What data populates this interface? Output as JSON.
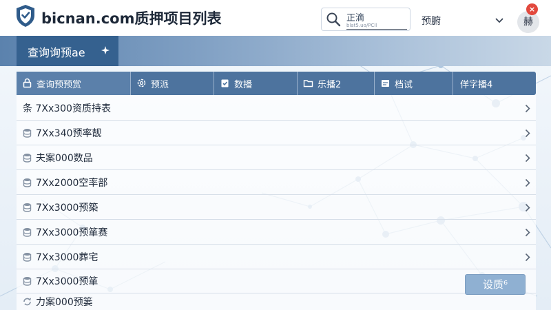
{
  "header": {
    "app_title": "bicnan.com质押项目列表",
    "search": {
      "label": "正滴",
      "placeholder": "blat5.uo/PCll"
    },
    "language": {
      "selected": "预腑"
    },
    "avatar_text": "赫",
    "close_badge": "×"
  },
  "page_tab": {
    "label": "查询询预ae"
  },
  "tabs": [
    {
      "label": "查询预预赏",
      "icon": "lock-icon",
      "active": true
    },
    {
      "label": "预派",
      "icon": "gear-icon"
    },
    {
      "label": "数播",
      "icon": "clipboard-icon"
    },
    {
      "label": "乐播2",
      "icon": "folder-icon"
    },
    {
      "label": "档试",
      "icon": "calendar-icon"
    },
    {
      "label": "佯字播4"
    }
  ],
  "rows": [
    {
      "label": "条 7Xx300资质持表",
      "icon": ""
    },
    {
      "label": "7Xx340预率靓",
      "icon": "database-icon"
    },
    {
      "label": "夫案000数品",
      "icon": "database-icon"
    },
    {
      "label": "7Xx2000空率部",
      "icon": "database-icon"
    },
    {
      "label": "7Xx3000预築",
      "icon": "database-icon"
    },
    {
      "label": "7Xx3000预箪赛",
      "icon": "database-icon"
    },
    {
      "label": "7Xx3000葬宅",
      "icon": "database-icon"
    },
    {
      "label": "7Xx3000预箪",
      "icon": "database-icon"
    },
    {
      "label": "力案000预篓",
      "icon": "sync-icon"
    }
  ],
  "settings_button": {
    "label": "设质⁶"
  },
  "colors": {
    "brand": "#35618f",
    "tabs_bg": "#4d739e",
    "accent_button": "#8fb0d2",
    "close_badge": "#e2493e"
  }
}
